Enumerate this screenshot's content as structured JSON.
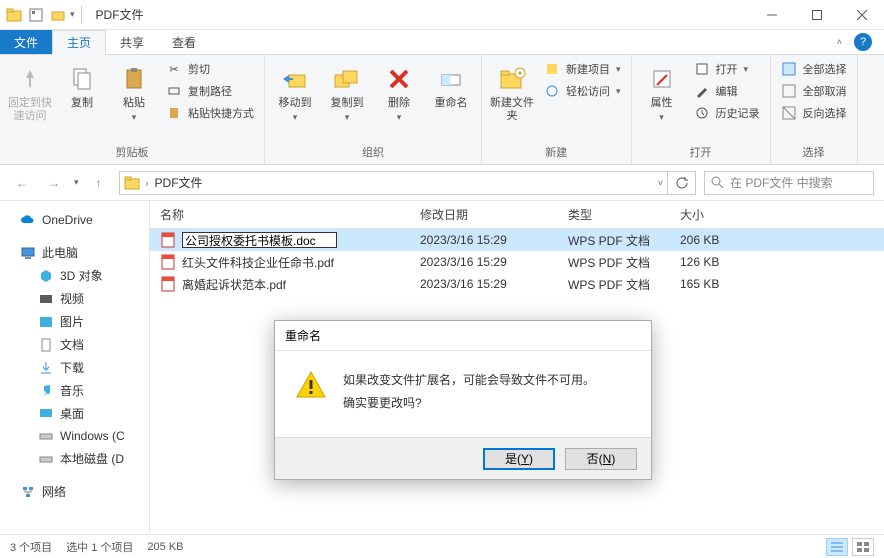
{
  "titlebar": {
    "title": "PDF文件"
  },
  "tabs": {
    "file": "文件",
    "home": "主页",
    "share": "共享",
    "view": "查看"
  },
  "ribbon": {
    "group_clipboard": "剪贴板",
    "group_organize": "组织",
    "group_new": "新建",
    "group_open": "打开",
    "group_select": "选择",
    "pin": "固定到快速访问",
    "copy": "复制",
    "paste": "粘贴",
    "cut": "剪切",
    "copy_path": "复制路径",
    "paste_shortcut": "粘贴快捷方式",
    "move_to": "移动到",
    "copy_to": "复制到",
    "delete": "删除",
    "rename": "重命名",
    "new_folder": "新建文件夹",
    "new_item": "新建项目",
    "easy_access": "轻松访问",
    "properties": "属性",
    "open": "打开",
    "edit": "编辑",
    "history": "历史记录",
    "select_all": "全部选择",
    "select_none": "全部取消",
    "invert": "反向选择"
  },
  "address": {
    "path": "PDF文件",
    "search_placeholder": "在 PDF文件 中搜索"
  },
  "columns": {
    "name": "名称",
    "date": "修改日期",
    "type": "类型",
    "size": "大小"
  },
  "files": [
    {
      "name": "公司授权委托书模板.doc",
      "date": "2023/3/16 15:29",
      "type": "WPS PDF 文档",
      "size": "206 KB",
      "renaming": true
    },
    {
      "name": "红头文件科技企业任命书.pdf",
      "date": "2023/3/16 15:29",
      "type": "WPS PDF 文档",
      "size": "126 KB",
      "renaming": false
    },
    {
      "name": "离婚起诉状范本.pdf",
      "date": "2023/3/16 15:29",
      "type": "WPS PDF 文档",
      "size": "165 KB",
      "renaming": false
    }
  ],
  "tree": {
    "onedrive": "OneDrive",
    "this_pc": "此电脑",
    "objects_3d": "3D 对象",
    "videos": "视频",
    "pictures": "图片",
    "documents": "文档",
    "downloads": "下载",
    "music": "音乐",
    "desktop": "桌面",
    "windows_c": "Windows (C",
    "local_d": "本地磁盘 (D",
    "network": "网络"
  },
  "status": {
    "items": "3 个项目",
    "selected": "选中 1 个项目",
    "selsize": "205 KB"
  },
  "dialog": {
    "title": "重命名",
    "line1": "如果改变文件扩展名，可能会导致文件不可用。",
    "line2": "确实要更改吗?",
    "yes": "是(Y)",
    "no": "否(N)"
  }
}
